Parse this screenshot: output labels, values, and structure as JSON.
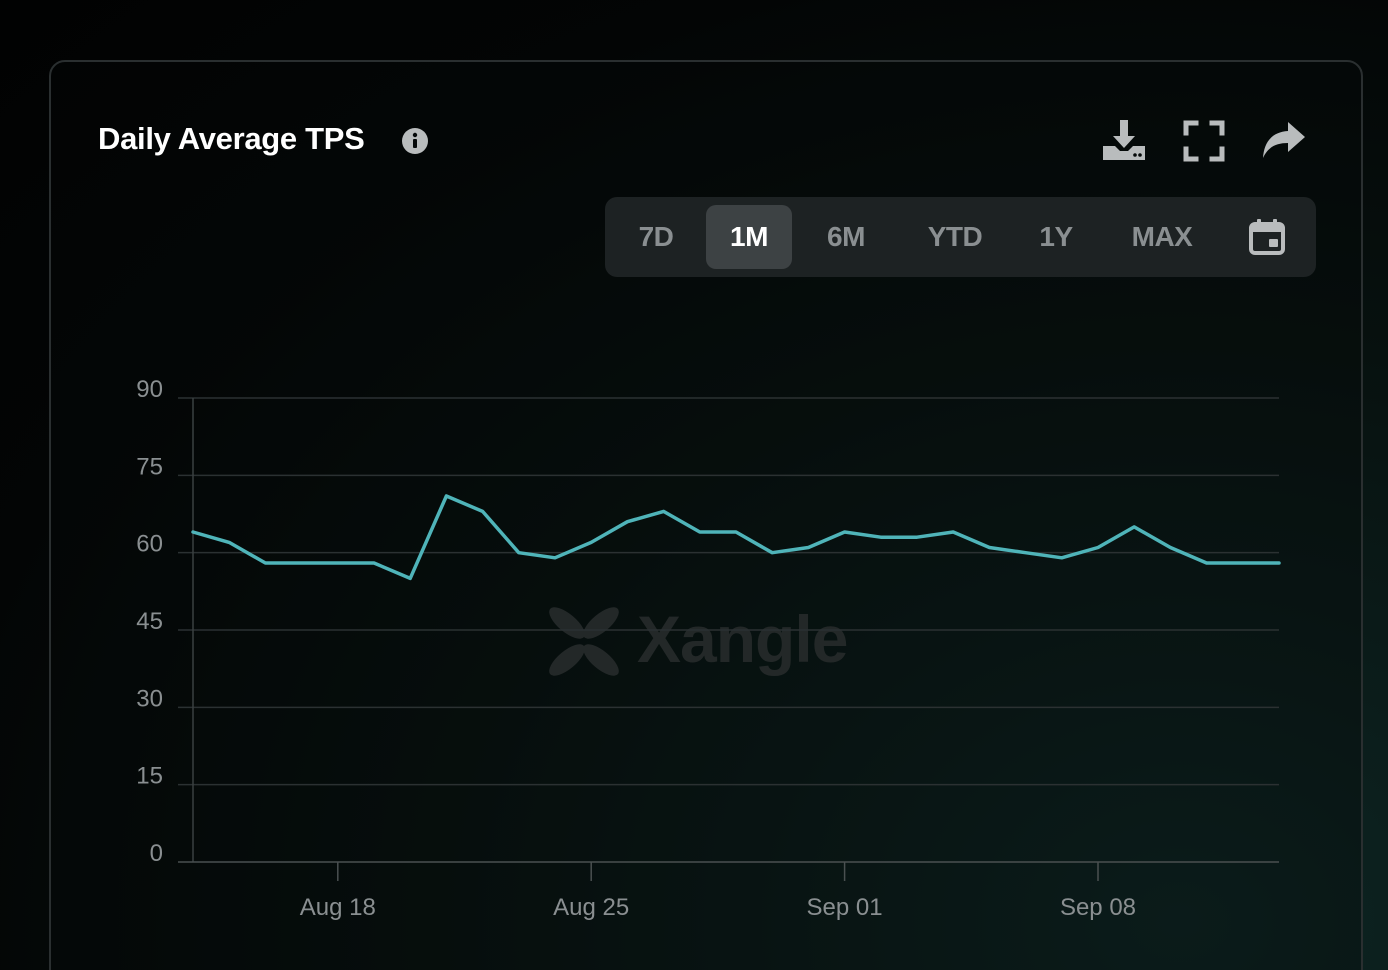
{
  "header": {
    "title": "Daily Average TPS",
    "info_icon": "info-icon",
    "toolbar": [
      {
        "name": "download-icon",
        "icon": "download"
      },
      {
        "name": "fullscreen-icon",
        "icon": "fullscreen"
      },
      {
        "name": "share-icon",
        "icon": "share"
      }
    ]
  },
  "ranges": {
    "items": [
      "7D",
      "1M",
      "6M",
      "YTD",
      "1Y",
      "MAX"
    ],
    "selected": "1M",
    "calendar_icon": "calendar-icon"
  },
  "watermark": {
    "text": "Xangle"
  },
  "colors": {
    "line": "#4fb4b9",
    "grid": "#2b3132",
    "axis_text": "#8a8f91",
    "background": "#050909"
  },
  "chart_data": {
    "type": "line",
    "title": "Daily Average TPS",
    "ylim": [
      0,
      90
    ],
    "yticks": [
      0,
      15,
      30,
      45,
      60,
      75,
      90
    ],
    "xticks": [
      "Aug 18",
      "Aug 25",
      "Sep 01",
      "Sep 08"
    ],
    "xtick_dates": [
      "2024-08-18",
      "2024-08-25",
      "2024-09-01",
      "2024-09-08"
    ],
    "grid": true,
    "series": [
      {
        "x": [
          "2024-08-14",
          "2024-08-15",
          "2024-08-16",
          "2024-08-17",
          "2024-08-18",
          "2024-08-19",
          "2024-08-20",
          "2024-08-21",
          "2024-08-22",
          "2024-08-23",
          "2024-08-24",
          "2024-08-25",
          "2024-08-26",
          "2024-08-27",
          "2024-08-28",
          "2024-08-29",
          "2024-08-30",
          "2024-08-31",
          "2024-09-01",
          "2024-09-02",
          "2024-09-03",
          "2024-09-04",
          "2024-09-05",
          "2024-09-06",
          "2024-09-07",
          "2024-09-08",
          "2024-09-09",
          "2024-09-10",
          "2024-09-11",
          "2024-09-12",
          "2024-09-13"
        ],
        "values": [
          64,
          62,
          58,
          58,
          58,
          58,
          55,
          71,
          68,
          60,
          59,
          62,
          66,
          68,
          64,
          64,
          60,
          61,
          64,
          63,
          63,
          64,
          61,
          60,
          59,
          61,
          65,
          61,
          58,
          58,
          58
        ]
      }
    ]
  }
}
